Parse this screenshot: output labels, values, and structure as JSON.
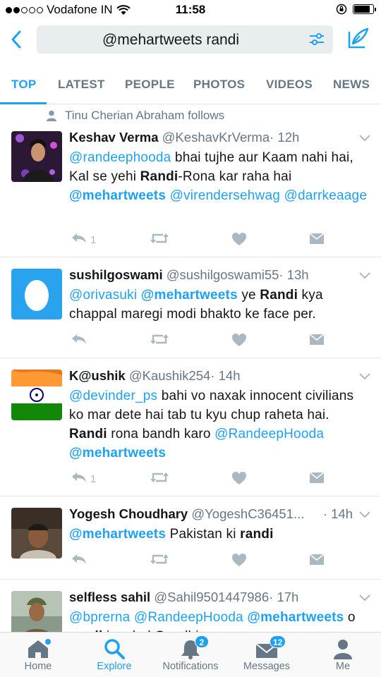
{
  "status_bar": {
    "carrier": "Vodafone IN",
    "time": "11:58",
    "battery_level": 0.85
  },
  "search": {
    "query": "@mehartweets randi"
  },
  "tabs": [
    "TOP",
    "LATEST",
    "PEOPLE",
    "PHOTOS",
    "VIDEOS",
    "NEWS"
  ],
  "active_tab": "TOP",
  "context_line": "Tinu Cherian Abraham follows",
  "tweets": [
    {
      "name": "Keshav Verma",
      "handle": "@KeshavKrVerma",
      "time": "· 12h",
      "reply_count": "1",
      "body": [
        {
          "t": "@randeephooda",
          "c": "mention"
        },
        {
          "t": " bhai tujhe aur Kaam nahi hai, Kal se yehi ",
          "c": ""
        },
        {
          "t": "Randi",
          "c": "b"
        },
        {
          "t": "-Rona kar raha hai ",
          "c": ""
        },
        {
          "t": "@mehartweets",
          "c": "mention b"
        },
        {
          "t": " ",
          "c": ""
        },
        {
          "t": "@virendersehwag",
          "c": "mention"
        },
        {
          "t": " ",
          "c": ""
        },
        {
          "t": "@darrkeaage",
          "c": "mention"
        }
      ]
    },
    {
      "name": "sushilgoswami",
      "handle": "@sushilgoswami55",
      "time": "· 13h",
      "reply_count": "",
      "body": [
        {
          "t": "@orivasuki",
          "c": "mention"
        },
        {
          "t": " ",
          "c": ""
        },
        {
          "t": "@mehartweets",
          "c": "mention b"
        },
        {
          "t": " ye ",
          "c": ""
        },
        {
          "t": "Randi",
          "c": "b"
        },
        {
          "t": " kya chappal maregi modi bhakto ke face per.",
          "c": ""
        }
      ]
    },
    {
      "name": "K@ushik",
      "handle": "@Kaushik254",
      "time": "· 14h",
      "reply_count": "1",
      "body": [
        {
          "t": "@devinder_ps",
          "c": "mention"
        },
        {
          "t": "  bahi vo naxak innocent civilians ko mar dete hai tab tu kyu chup raheta hai. ",
          "c": ""
        },
        {
          "t": "Randi",
          "c": "b"
        },
        {
          "t": " rona bandh karo ",
          "c": ""
        },
        {
          "t": "@RandeepHooda",
          "c": "mention"
        },
        {
          "t": " ",
          "c": ""
        },
        {
          "t": "@mehartweets",
          "c": "mention b"
        }
      ]
    },
    {
      "name": "Yogesh Choudhary",
      "handle": "@YogeshC36451...",
      "time": "· 14h",
      "reply_count": "",
      "body": [
        {
          "t": "@mehartweets",
          "c": "mention b"
        },
        {
          "t": " Pakistan ki ",
          "c": ""
        },
        {
          "t": "randi",
          "c": "b"
        }
      ]
    },
    {
      "name": "selfless sahil",
      "handle": "@Sahil9501447986",
      "time": "· 17h",
      "reply_count": "",
      "body": [
        {
          "t": "@bprerna",
          "c": "mention"
        },
        {
          "t": " ",
          "c": ""
        },
        {
          "t": "@RandeepHooda",
          "c": "mention"
        },
        {
          "t": " ",
          "c": ""
        },
        {
          "t": "@mehartweets",
          "c": "mention b"
        },
        {
          "t": " o ",
          "c": ""
        },
        {
          "t": "randi",
          "c": "b"
        },
        {
          "t": " is rahul Gandhi ee",
          "c": ""
        }
      ]
    }
  ],
  "tabbar": {
    "home": "Home",
    "explore": "Explore",
    "notifications": "Notifications",
    "notifications_badge": "2",
    "messages": "Messages",
    "messages_badge": "12",
    "me": "Me"
  },
  "colors": {
    "accent": "#1da1f2",
    "secondary_text": "#657786",
    "action_icon": "#aab8c2"
  }
}
